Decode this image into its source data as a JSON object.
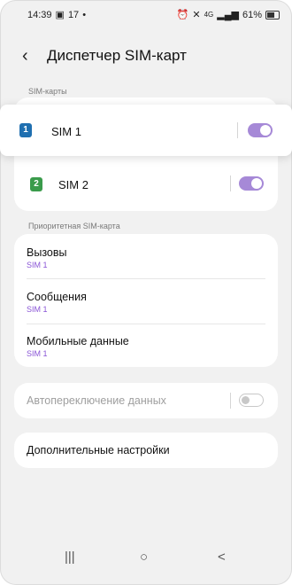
{
  "status_bar": {
    "time": "14:39",
    "left_icons": [
      "gallery-icon",
      "signal-17-icon",
      "notification-icon"
    ],
    "battery": "61%"
  },
  "header": {
    "title": "Диспетчер SIM-карт"
  },
  "sim_section": {
    "label": "SIM-карты",
    "sims": [
      {
        "badge": "1",
        "name": "SIM 1",
        "color": "#1f6fb0",
        "enabled": true
      },
      {
        "badge": "2",
        "name": "SIM 2",
        "color": "#3a9b4b",
        "enabled": true
      }
    ]
  },
  "priority_section": {
    "label": "Приоритетная SIM-карта",
    "items": [
      {
        "title": "Вызовы",
        "value": "SIM 1"
      },
      {
        "title": "Сообщения",
        "value": "SIM 1"
      },
      {
        "title": "Мобильные данные",
        "value": "SIM 1"
      }
    ]
  },
  "auto_switch": {
    "label": "Автопереключение данных",
    "enabled": false
  },
  "more_settings": {
    "label": "Дополнительные настройки"
  },
  "navbar": {
    "recent": "|||",
    "home": "○",
    "back": "<"
  },
  "colors": {
    "accent": "#a689d7",
    "sub_text": "#8a55d6"
  }
}
